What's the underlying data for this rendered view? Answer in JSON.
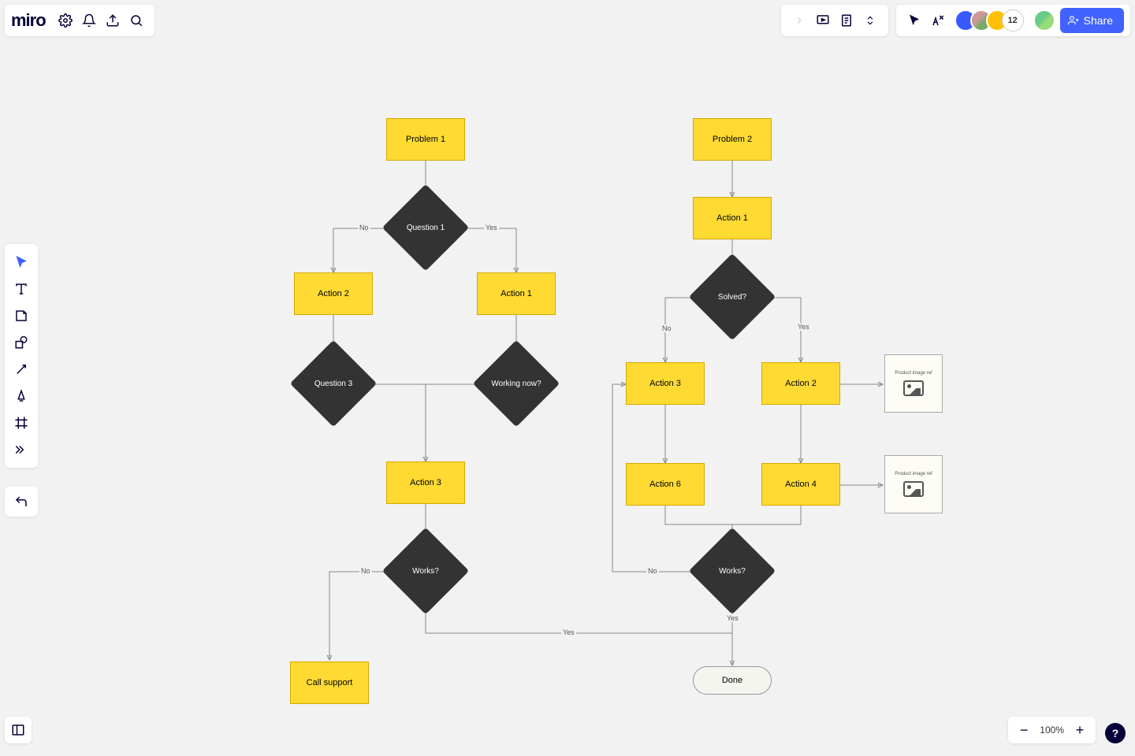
{
  "app": {
    "logo": "miro"
  },
  "header": {
    "collaborator_overflow": "12",
    "share_label": "Share"
  },
  "zoom": {
    "level": "100%"
  },
  "help": {
    "label": "?"
  },
  "flowchart": {
    "left": {
      "problem": "Problem 1",
      "question1": "Question 1",
      "yes1": "Yes",
      "no1": "No",
      "action1": "Action 1",
      "action2": "Action 2",
      "question3": "Question 3",
      "working_now": "Working now?",
      "action3": "Action 3",
      "works": "Works?",
      "works_no": "No",
      "works_yes": "Yes",
      "call_support": "Call support"
    },
    "right": {
      "problem": "Problem 2",
      "action1": "Action 1",
      "solved": "Solved?",
      "no": "No",
      "yes": "Yes",
      "action3": "Action 3",
      "action2": "Action 2",
      "action6": "Action 6",
      "action4": "Action 4",
      "img1": "Product image ref",
      "img2": "Product image ref",
      "works": "Works?",
      "works_no": "No",
      "works_yes": "Yes",
      "done": "Done"
    }
  }
}
